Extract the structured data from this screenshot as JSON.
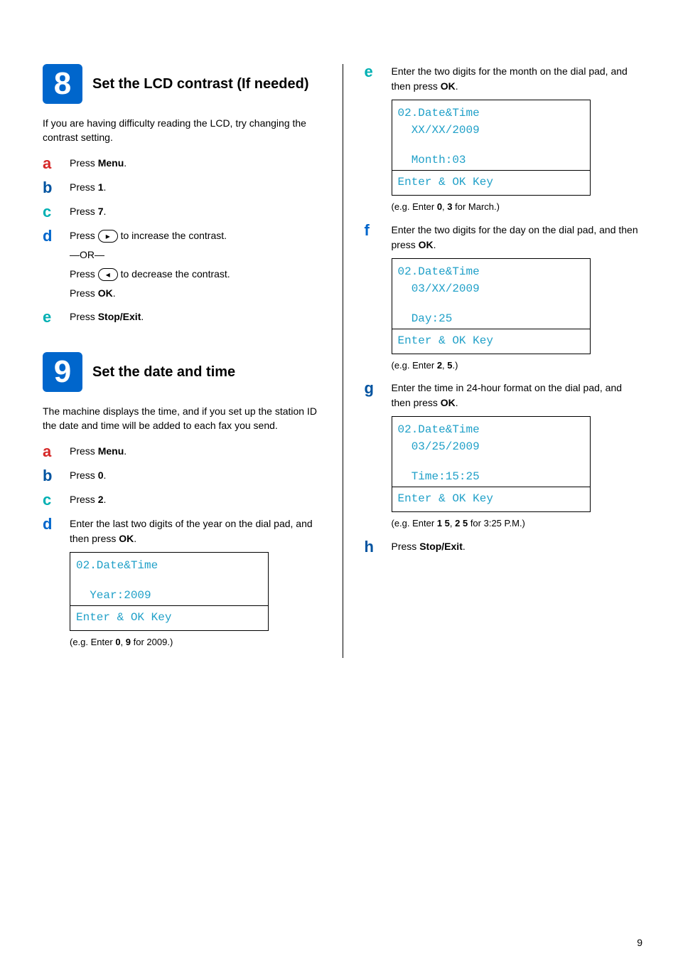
{
  "section8": {
    "num": "8",
    "title": "Set the LCD contrast (If needed)",
    "intro": "If you are having difficulty reading the LCD, try changing the contrast setting.",
    "steps": {
      "a": {
        "html": "Press <b>Menu</b>."
      },
      "b": {
        "html": "Press <b>1</b>."
      },
      "c": {
        "html": "Press <b>7</b>."
      },
      "d": {
        "line1_before": "Press ",
        "key1": "▸",
        "line1_after": " to increase the contrast.",
        "or": "—OR—",
        "line2_before": "Press ",
        "key2": "◂",
        "line2_after": " to decrease the contrast.",
        "ok": "Press <b>OK</b>."
      },
      "e": {
        "html": "Press <b>Stop/Exit</b>."
      }
    }
  },
  "section9": {
    "num": "9",
    "title": "Set the date and time",
    "intro": "The machine displays the time, and if you set up the station ID the date and time will be added to each fax you send.",
    "steps": {
      "a": {
        "html": "Press <b>Menu</b>."
      },
      "b": {
        "html": "Press <b>0</b>."
      },
      "c": {
        "html": "Press <b>2</b>."
      },
      "d": {
        "text": "Enter the last two digits of the year on the dial pad, and then press <b>OK</b>.",
        "lcd": {
          "l1": "02.Date&Time",
          "l2": "",
          "l3": "  Year:2009",
          "bot": "Enter & OK Key"
        },
        "note": "(e.g. Enter <b>0</b>, <b>9</b> for 2009.)"
      },
      "e": {
        "text": "Enter the two digits for the month on the dial pad, and then press <b>OK</b>.",
        "lcd": {
          "l1": "02.Date&Time",
          "l2": "  XX/XX/2009",
          "l3": "  Month:03",
          "bot": "Enter & OK Key"
        },
        "note": "(e.g. Enter <b>0</b>, <b>3</b> for March.)"
      },
      "f": {
        "text": "Enter the two digits for the day on the dial pad, and then press <b>OK</b>.",
        "lcd": {
          "l1": "02.Date&Time",
          "l2": "  03/XX/2009",
          "l3": "  Day:25",
          "bot": "Enter & OK Key"
        },
        "note": "(e.g. Enter <b>2</b>, <b>5</b>.)"
      },
      "g": {
        "text": "Enter the time in 24-hour format on the dial pad, and then press <b>OK</b>.",
        "lcd": {
          "l1": "02.Date&Time",
          "l2": "  03/25/2009",
          "l3": "  Time:15:25",
          "bot": "Enter & OK Key"
        },
        "note": "(e.g. Enter <b>1 5</b>, <b>2 5</b> for 3:25 P.M.)"
      },
      "h": {
        "html": "Press <b>Stop/Exit</b>."
      }
    }
  },
  "page": "9"
}
